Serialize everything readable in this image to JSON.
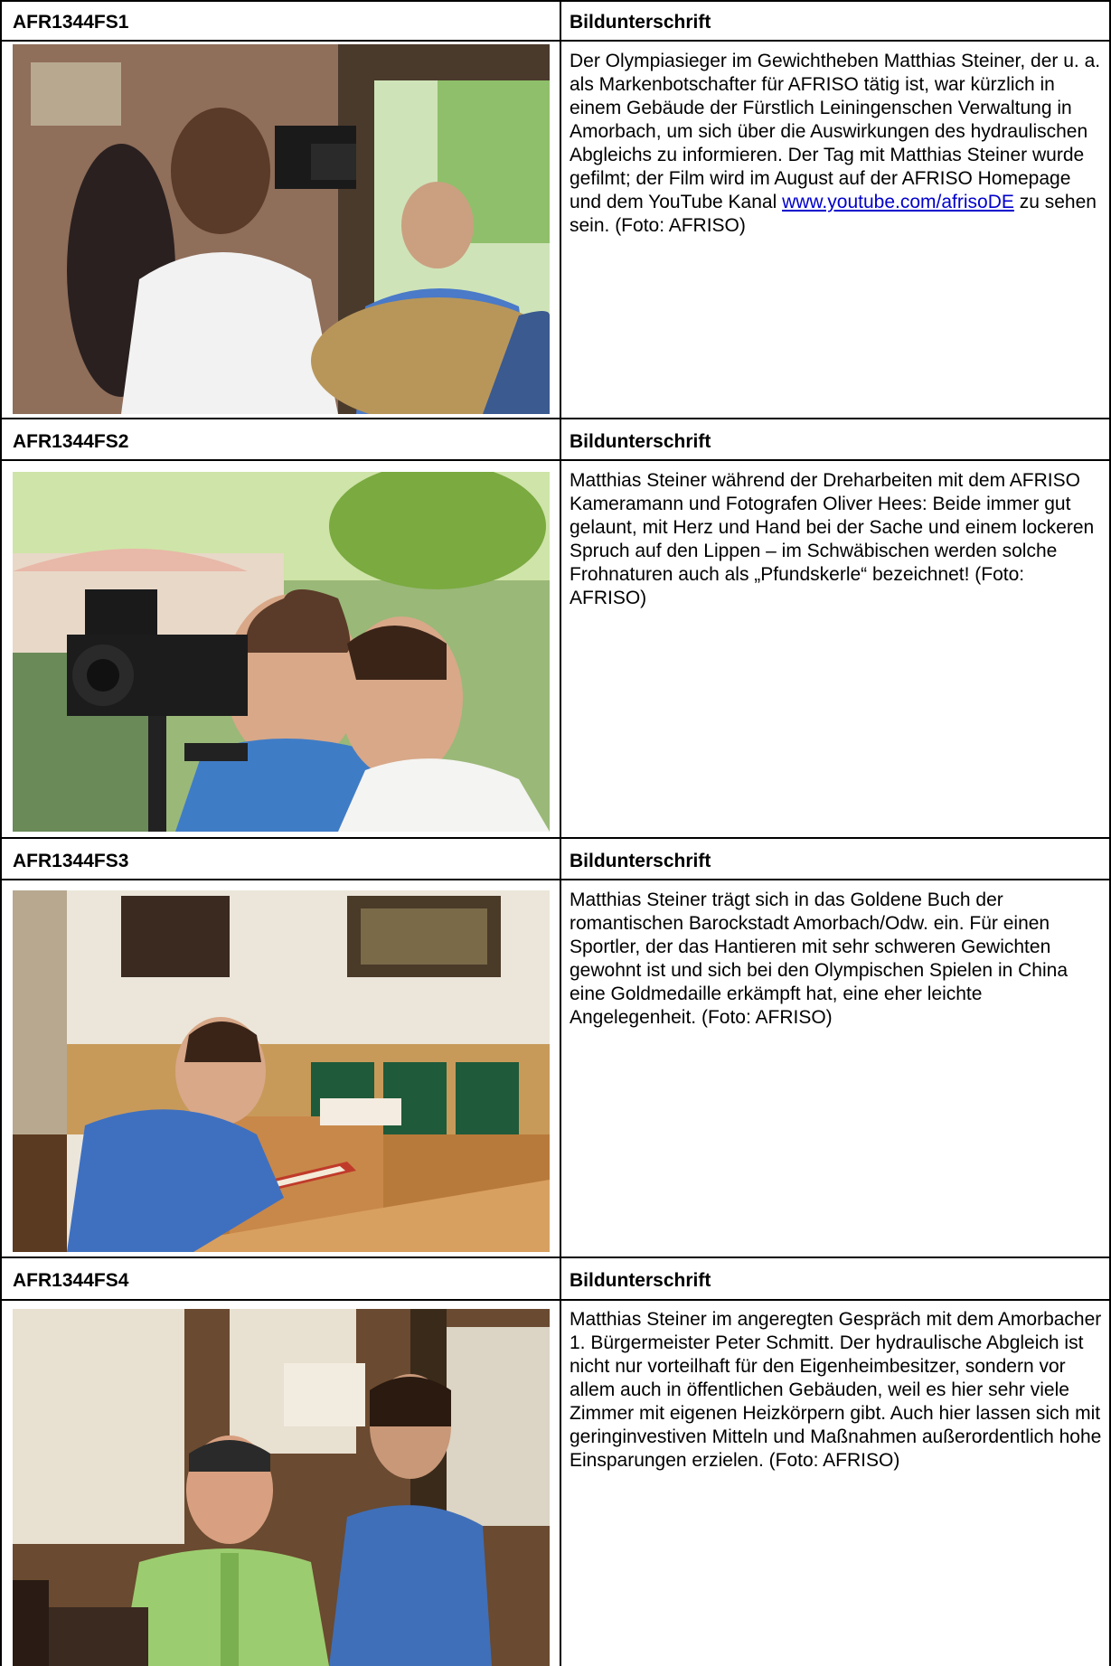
{
  "rows": [
    {
      "id": "AFR1344FS1",
      "header": "Bildunterschrift",
      "caption_before_link": "Der Olympiasieger im Gewichtheben Matthias Steiner, der u. a. als Markenbotschafter für AFRISO tätig ist, war kürzlich in einem Gebäude der Fürstlich Leiningenschen Verwaltung in Amorbach, um sich über die Auswirkungen des hydraulischen Abgleichs zu informieren. Der Tag mit Matthias Steiner wurde gefilmt; der Film wird im August auf der AFRISO Homepage und dem YouTube Kanal ",
      "caption_link": "www.youtube.com/afrisoDE",
      "caption_after_link": " zu sehen sein. (Foto: AFRISO)"
    },
    {
      "id": "AFR1344FS2",
      "header": "Bildunterschrift",
      "caption": "Matthias Steiner während der Dreharbeiten mit dem AFRISO Kameramann und Fotografen Oliver Hees: Beide immer gut gelaunt, mit Herz und Hand bei der Sache und einem lockeren Spruch auf den Lippen – im Schwäbischen werden solche Frohnaturen auch als „Pfundskerle“ bezeichnet! (Foto: AFRISO)"
    },
    {
      "id": "AFR1344FS3",
      "header": "Bildunterschrift",
      "caption": "Matthias Steiner trägt sich in das Goldene Buch der romantischen Barockstadt Amorbach/Odw. ein. Für einen Sportler, der das Hantieren mit sehr schweren Gewichten gewohnt ist und sich bei den Olympischen Spielen in China eine Goldmedaille erkämpft hat, eine eher leichte Angelegenheit. (Foto: AFRISO)"
    },
    {
      "id": "AFR1344FS4",
      "header": "Bildunterschrift",
      "caption": "Matthias Steiner im angeregten Gespräch mit dem Amorbacher 1. Bürgermeister Peter Schmitt. Der hydraulische Abgleich ist nicht nur vorteilhaft für den Eigenheimbesitzer, sondern vor allem auch in öffentlichen Gebäuden, weil es hier sehr viele Zimmer mit eigenen Heizkörpern gibt. Auch hier lassen sich mit geringinvestiven Mitteln und Maßnahmen außerordentlich hohe Einsparungen erzielen. (Foto: AFRISO)"
    }
  ],
  "photos": [
    {
      "name": "photo-film-crew",
      "sky": "#cfe3b8",
      "wall": "#8a6a58",
      "accent": "#4a7ac8",
      "shirt": "#f2f2f2"
    },
    {
      "name": "photo-cameraman",
      "sky": "#cfe4a8",
      "wall": "#6a9a50",
      "accent": "#3f7cc6",
      "shirt": "#f4f4f2"
    },
    {
      "name": "photo-golden-book",
      "sky": "#ece6da",
      "wall": "#c89a5a",
      "accent": "#3f70c0",
      "shirt": "#8a5a2a"
    },
    {
      "name": "photo-mayor-talk",
      "sky": "#e8e0d0",
      "wall": "#6a4a30",
      "accent": "#3f6fb8",
      "shirt": "#9ccc70"
    }
  ]
}
